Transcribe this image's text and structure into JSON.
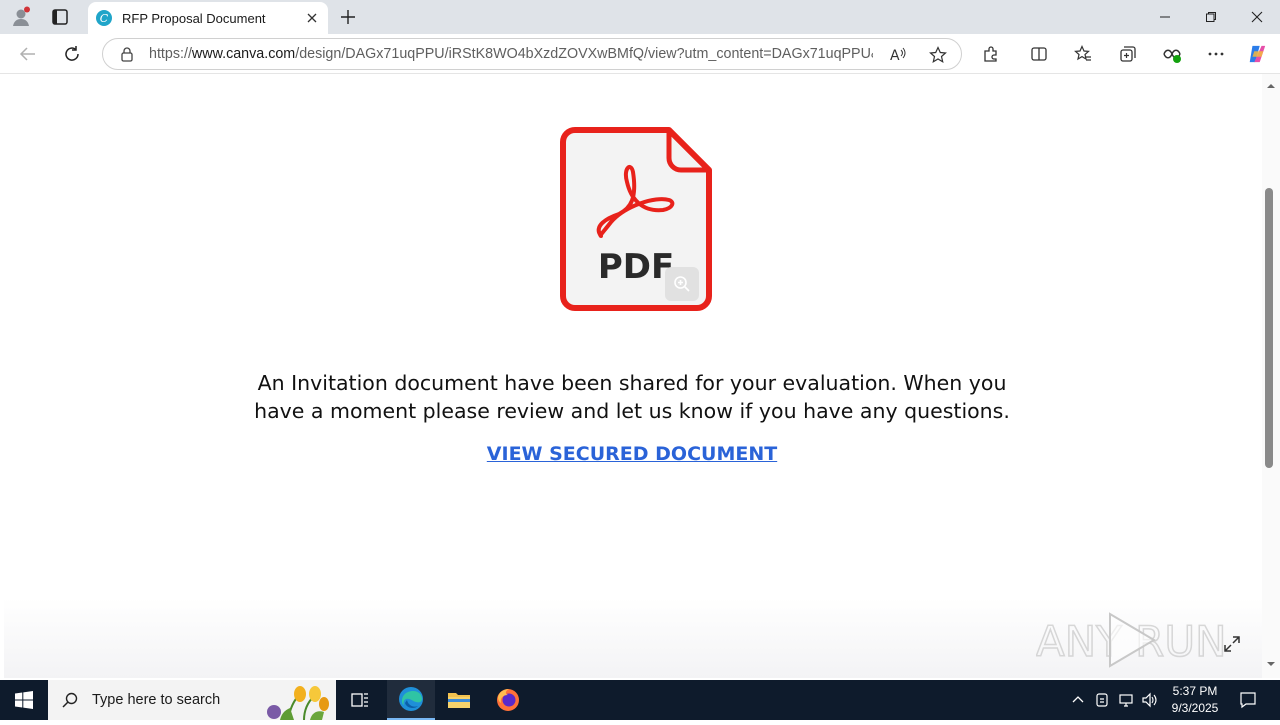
{
  "browser": {
    "tab_title": "RFP Proposal Document",
    "url_prefix": "https://",
    "url_domain": "www.canva.com",
    "url_path": "/design/DAGx71uqPPU/iRStK8WO4bXzdZOVXwBMfQ/view?utm_content=DAGx71uqPPU&u...",
    "icons": [
      "profile-icon",
      "tab-actions-icon",
      "canva-favicon",
      "close-tab-icon",
      "new-tab-icon",
      "minimize-icon",
      "restore-icon",
      "close-window-icon",
      "back-icon",
      "refresh-icon",
      "lock-icon",
      "read-aloud-icon",
      "favorite-star-icon",
      "extensions-icon",
      "split-screen-icon",
      "favorites-icon",
      "collections-icon",
      "browser-essentials-icon",
      "more-icon",
      "copilot-icon"
    ]
  },
  "page": {
    "pdf_label": "PDF",
    "message": "An Invitation document have been shared for your evaluation. When you have a moment please review and let us know if you have any questions.",
    "cta_label": "VIEW SECURED DOCUMENT",
    "watermark": "ANY RUN"
  },
  "taskbar": {
    "search_placeholder": "Type here to search",
    "time": "5:37 PM",
    "date": "9/3/2025",
    "apps": [
      "task-view",
      "edge",
      "file-explorer",
      "firefox"
    ]
  },
  "colors": {
    "pdf_red": "#e8221b",
    "link_blue": "#2a63d8",
    "taskbar_bg": "#0e1b2c",
    "titlebar_bg": "#dfe3e8"
  }
}
